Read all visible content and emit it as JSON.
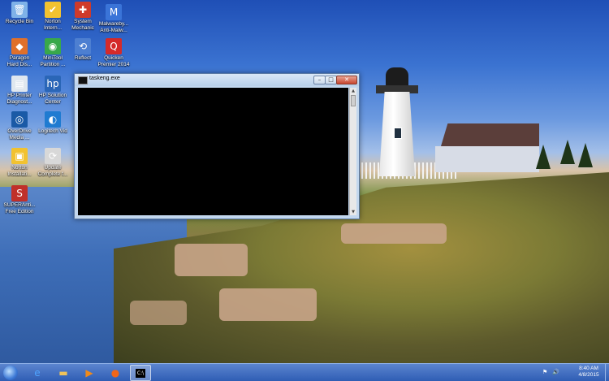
{
  "desktop": {
    "icons": [
      {
        "label": "Recycle Bin",
        "icon": "recycle-bin-icon",
        "color": "#7fb2e8",
        "glyph": "🗑"
      },
      {
        "label": "Norton\nIntern...",
        "icon": "norton-icon",
        "color": "#f2c230",
        "glyph": "✔"
      },
      {
        "label": "System\nMechanic",
        "icon": "system-mechanic-icon",
        "color": "#cf3a2a",
        "glyph": "✚"
      },
      {
        "label": "Malwareby...\nAnti-Malw...",
        "icon": "malwarebytes-icon",
        "color": "#3a74d8",
        "glyph": "M"
      },
      {
        "label": "Paragon\nHard Dis...",
        "icon": "paragon-icon",
        "color": "#e0702a",
        "glyph": "◆"
      },
      {
        "label": "MiniTool\nPartition ...",
        "icon": "minitool-icon",
        "color": "#38a84a",
        "glyph": "◉"
      },
      {
        "label": "Reflect",
        "icon": "reflect-icon",
        "color": "#4d7fd1",
        "glyph": "⟲"
      },
      {
        "label": "Quicken\nPremier 2014",
        "icon": "quicken-icon",
        "color": "#d42a2a",
        "glyph": "Q"
      },
      {
        "label": "HP Printer\nDiagnost...",
        "icon": "hp-printer-icon",
        "color": "#dfe7ef",
        "glyph": "▤"
      },
      {
        "label": "HP Solution\nCenter",
        "icon": "hp-solution-icon",
        "color": "#2a66b7",
        "glyph": "hp"
      },
      {
        "label": "OverDrive\nMedia ...",
        "icon": "overdrive-icon",
        "color": "#1a5aa6",
        "glyph": "◎"
      },
      {
        "label": "Logitech Vid",
        "icon": "logitech-icon",
        "color": "#1f7bd1",
        "glyph": "◐"
      },
      {
        "label": "Norton\nInstallati...",
        "icon": "norton-install-icon",
        "color": "#f2c230",
        "glyph": "▣"
      },
      {
        "label": "Update\nComplete f...",
        "icon": "update-icon",
        "color": "#d8d8d8",
        "glyph": "⟳"
      },
      {
        "label": "SUPERAnti...\nFree Edition",
        "icon": "superantispyware-icon",
        "color": "#c0302a",
        "glyph": "S"
      }
    ]
  },
  "window": {
    "title": "taskeng.exe",
    "buttons": {
      "minimize": "–",
      "maximize": "□",
      "close": "✕"
    },
    "scroll_up": "▲",
    "scroll_down": "▼"
  },
  "taskbar": {
    "apps": [
      {
        "name": "internet-explorer",
        "glyph": "e",
        "color": "#4ea3ff"
      },
      {
        "name": "file-explorer",
        "glyph": "▬",
        "color": "#f0c35a"
      },
      {
        "name": "media-player",
        "glyph": "▶",
        "color": "#f08a1a"
      },
      {
        "name": "firefox",
        "glyph": "●",
        "color": "#f0661a"
      },
      {
        "name": "command-prompt",
        "glyph": "C:\\",
        "color": "#000000"
      }
    ],
    "clock": {
      "time": "8:40 AM",
      "date": "4/8/2015"
    },
    "tray_flag": "⚑",
    "tray_volume": "🔊"
  }
}
